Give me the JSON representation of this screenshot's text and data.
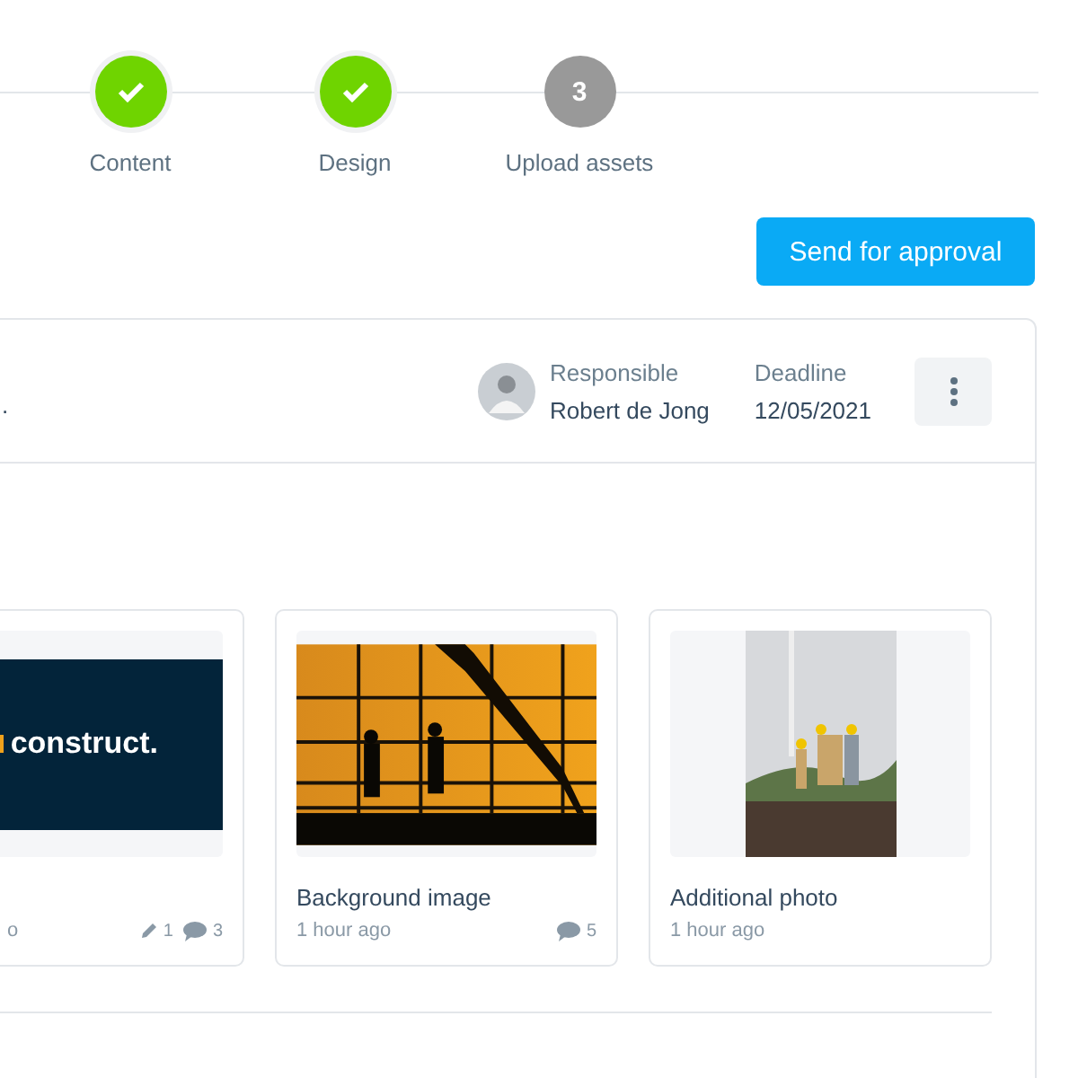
{
  "steps": [
    {
      "label": "Content",
      "done": true
    },
    {
      "label": "Design",
      "done": true
    },
    {
      "label": "Upload assets",
      "done": false,
      "number": "3"
    }
  ],
  "send_button": "Send for approval",
  "task": {
    "description": ".",
    "responsible_label": "Responsible",
    "responsible": "Robert de Jong",
    "deadline_label": "Deadline",
    "deadline": "12/05/2021"
  },
  "assets": [
    {
      "kind": "logo",
      "logo_text": "construct.",
      "time": "o",
      "edits": "1",
      "comments": "3"
    },
    {
      "kind": "sunset",
      "title": "Background image",
      "time": "1 hour ago",
      "comments": "5"
    },
    {
      "kind": "workers",
      "title": "Additional photo",
      "time": "1 hour ago"
    }
  ]
}
